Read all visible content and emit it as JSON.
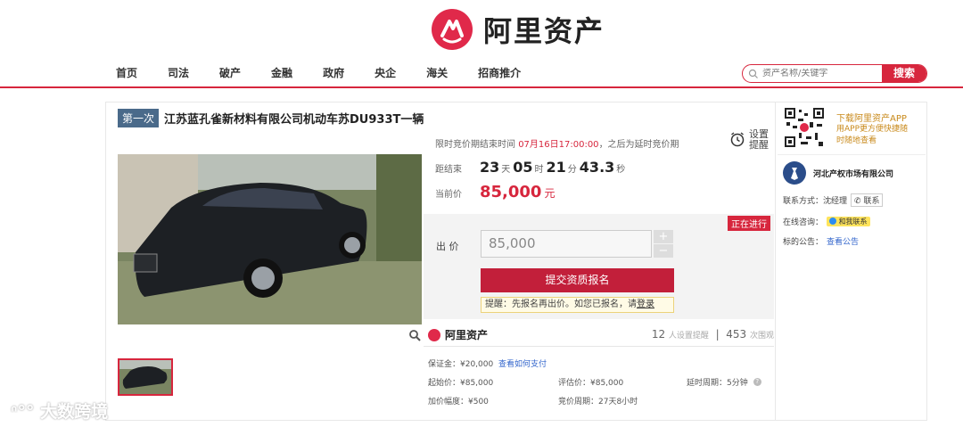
{
  "header": {
    "logo_text": "阿里资产",
    "nav": [
      "首页",
      "司法",
      "破产",
      "金融",
      "政府",
      "央企",
      "海关",
      "招商推介"
    ],
    "search_placeholder": "资产名称/关键字",
    "search_button": "搜索"
  },
  "lot": {
    "round": "第一次",
    "title": "江苏蓝孔雀新材料有限公司机动车苏DU933T一辆",
    "notice_prefix": "限时竞价期结束时间 ",
    "notice_time": "07月16日17:00:00",
    "notice_suffix": "，之后为延时竞价期",
    "set_remind": "设置提醒",
    "countdown_label": "距结束",
    "countdown": {
      "days": "23",
      "day_unit": "天",
      "hours": "05",
      "hour_unit": "时",
      "minutes": "21",
      "minute_unit": "分",
      "seconds": "43.3",
      "second_unit": "秒"
    },
    "price_label": "当前价",
    "price": "85,000",
    "price_unit": "元",
    "status": "正在进行",
    "bid_label": "出 价",
    "bid_value": "85,000",
    "step_plus": "+",
    "step_minus": "−",
    "submit_button": "提交资质报名",
    "tip_text": "提醒：先报名再出价。如您已报名，请",
    "tip_link": "登录"
  },
  "stats": {
    "brand": "阿里资产",
    "remind_count": "12",
    "remind_label": "人设置提醒",
    "view_count": "453",
    "view_label": "次围观"
  },
  "details": {
    "deposit": "保证金：¥20,000",
    "pay_link": "查看如何支付",
    "start_price": "起始价：¥85,000",
    "appraisal": "评估价：¥85,000",
    "extend": "延时周期：5分钟",
    "increment": "加价幅度：¥500",
    "period": "竞价周期：27天8小时"
  },
  "sidebar": {
    "app_title": "下载阿里资产APP",
    "app_sub": "用APP更方便快捷随时随地查看",
    "org_name": "河北产权市场有限公司",
    "contact_label": "联系方式：沈经理",
    "contact_button": "联系",
    "consult_label": "在线咨询：",
    "consult_button": "和我联系",
    "notice_label": "标的公告：",
    "notice_link": "查看公告"
  },
  "watermark": "大数跨境",
  "colors": {
    "brand_red": "#d7263d",
    "button_red": "#c21f3a",
    "link_blue": "#3366cc"
  }
}
